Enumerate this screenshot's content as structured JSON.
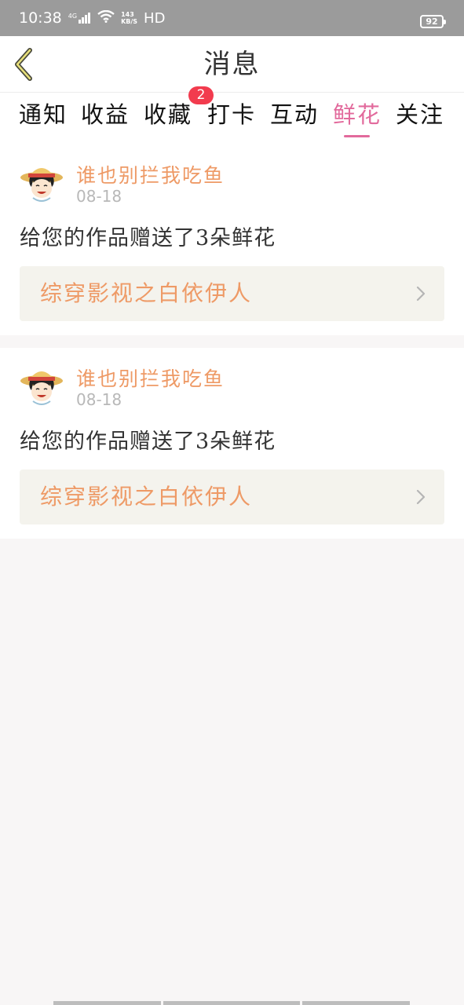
{
  "status_bar": {
    "time": "10:38",
    "network_type": "4G",
    "speed_value": "143",
    "speed_unit": "KB/S",
    "hd": "HD",
    "battery": "92"
  },
  "header": {
    "title": "消息",
    "back_icon": "chevron-left-icon"
  },
  "tabs": [
    {
      "label": "通知"
    },
    {
      "label": "收益"
    },
    {
      "label": "收藏",
      "badge": "2"
    },
    {
      "label": "打卡"
    },
    {
      "label": "互动"
    },
    {
      "label": "鲜花",
      "active": true
    },
    {
      "label": "关注"
    }
  ],
  "colors": {
    "accent": "#e26a9c",
    "username": "#ee9a66",
    "badge": "#f23b4e"
  },
  "messages": [
    {
      "user": "谁也别拦我吃鱼",
      "time": "08-18",
      "text": "给您的作品赠送了3朵鲜花",
      "work_title": "综穿影视之白依伊人"
    },
    {
      "user": "谁也别拦我吃鱼",
      "time": "08-18",
      "text": "给您的作品赠送了3朵鲜花",
      "work_title": "综穿影视之白依伊人"
    }
  ]
}
